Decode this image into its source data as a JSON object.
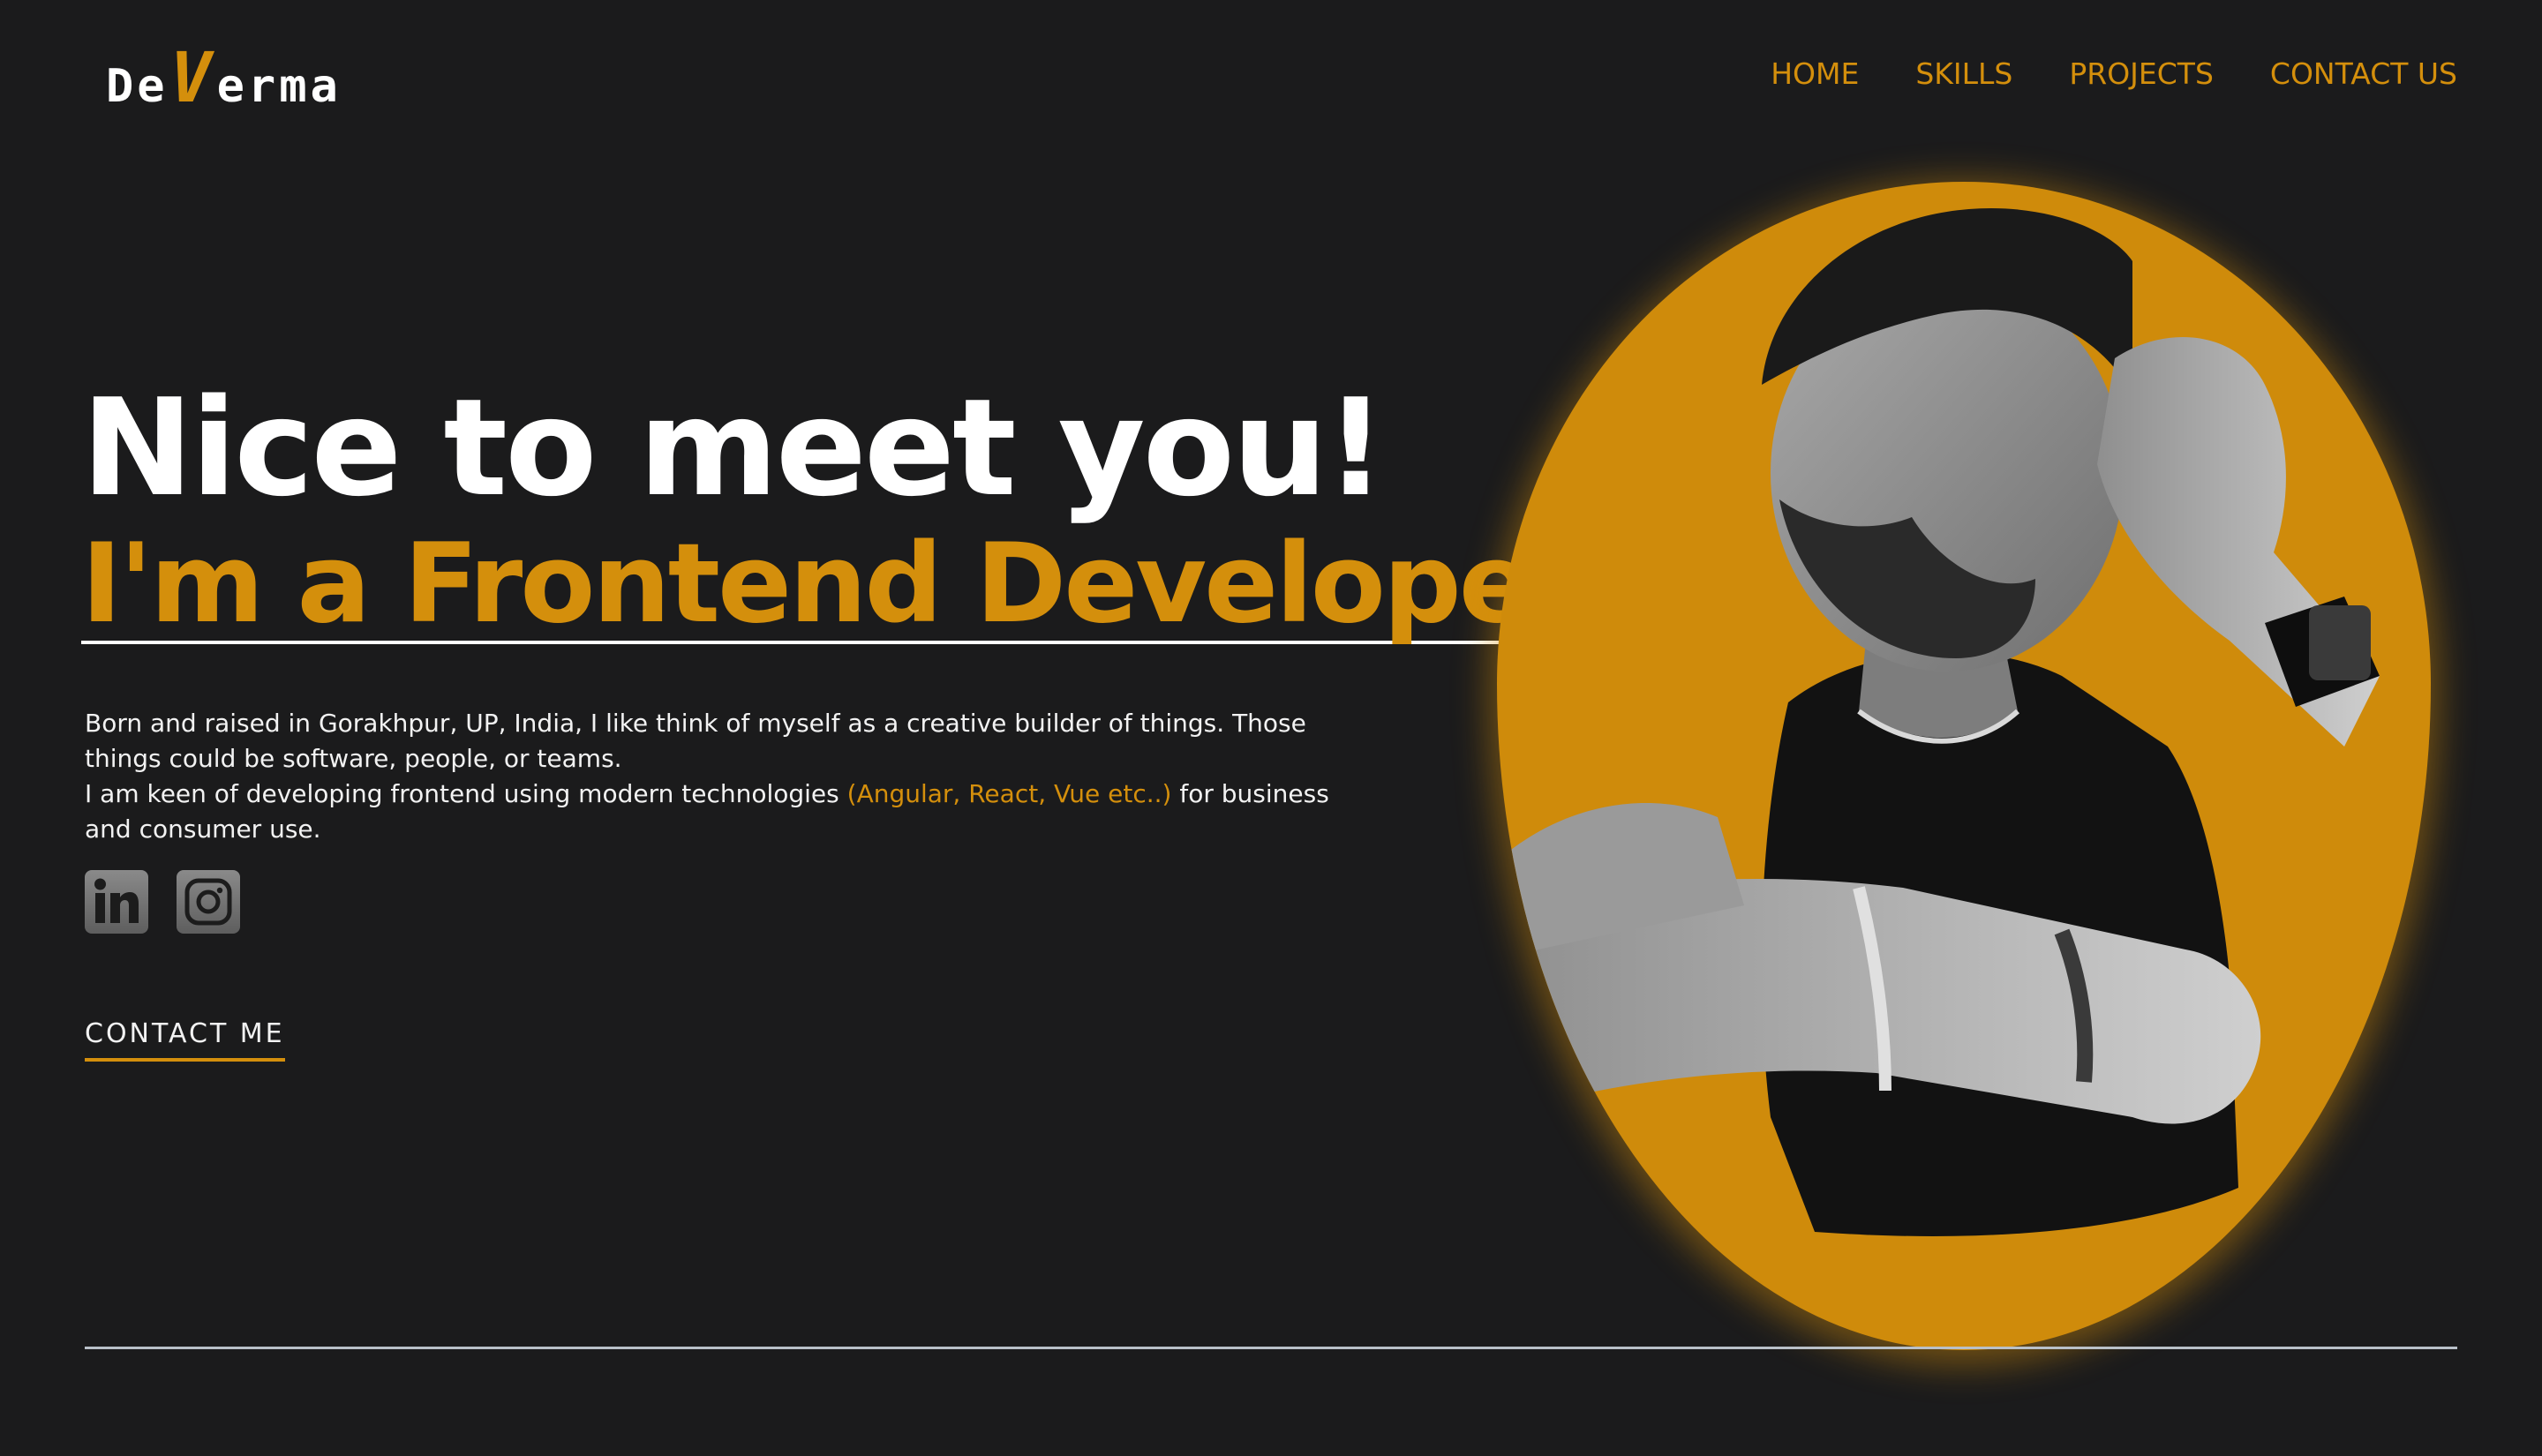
{
  "header": {
    "logo": {
      "prefix": "De",
      "highlight": "V",
      "suffix": "erma"
    },
    "nav": [
      {
        "label": "HOME"
      },
      {
        "label": "SKILLS"
      },
      {
        "label": "PROJECTS"
      },
      {
        "label": "CONTACT US"
      }
    ]
  },
  "hero": {
    "headline": "Nice to meet you!",
    "role": "I'm a Frontend Developer.",
    "bio": {
      "line1": "Born and raised in Gorakhpur, UP, India, I like think of myself as a creative builder of things. Those things could be software, people, or teams.",
      "line2_before": "I am keen of developing frontend using modern technologies ",
      "line2_accent": "(Angular, React, Vue etc..)",
      "line2_after": " for business and consumer use."
    },
    "social": [
      {
        "icon": "linkedin-icon"
      },
      {
        "icon": "instagram-icon"
      }
    ],
    "cta": "CONTACT ME"
  },
  "portrait": {
    "icon": "profile-photo"
  },
  "colors": {
    "background": "#1b1b1c",
    "accent": "#d48f0c",
    "text": "#ffffff",
    "divider": "#b9c0c8"
  }
}
